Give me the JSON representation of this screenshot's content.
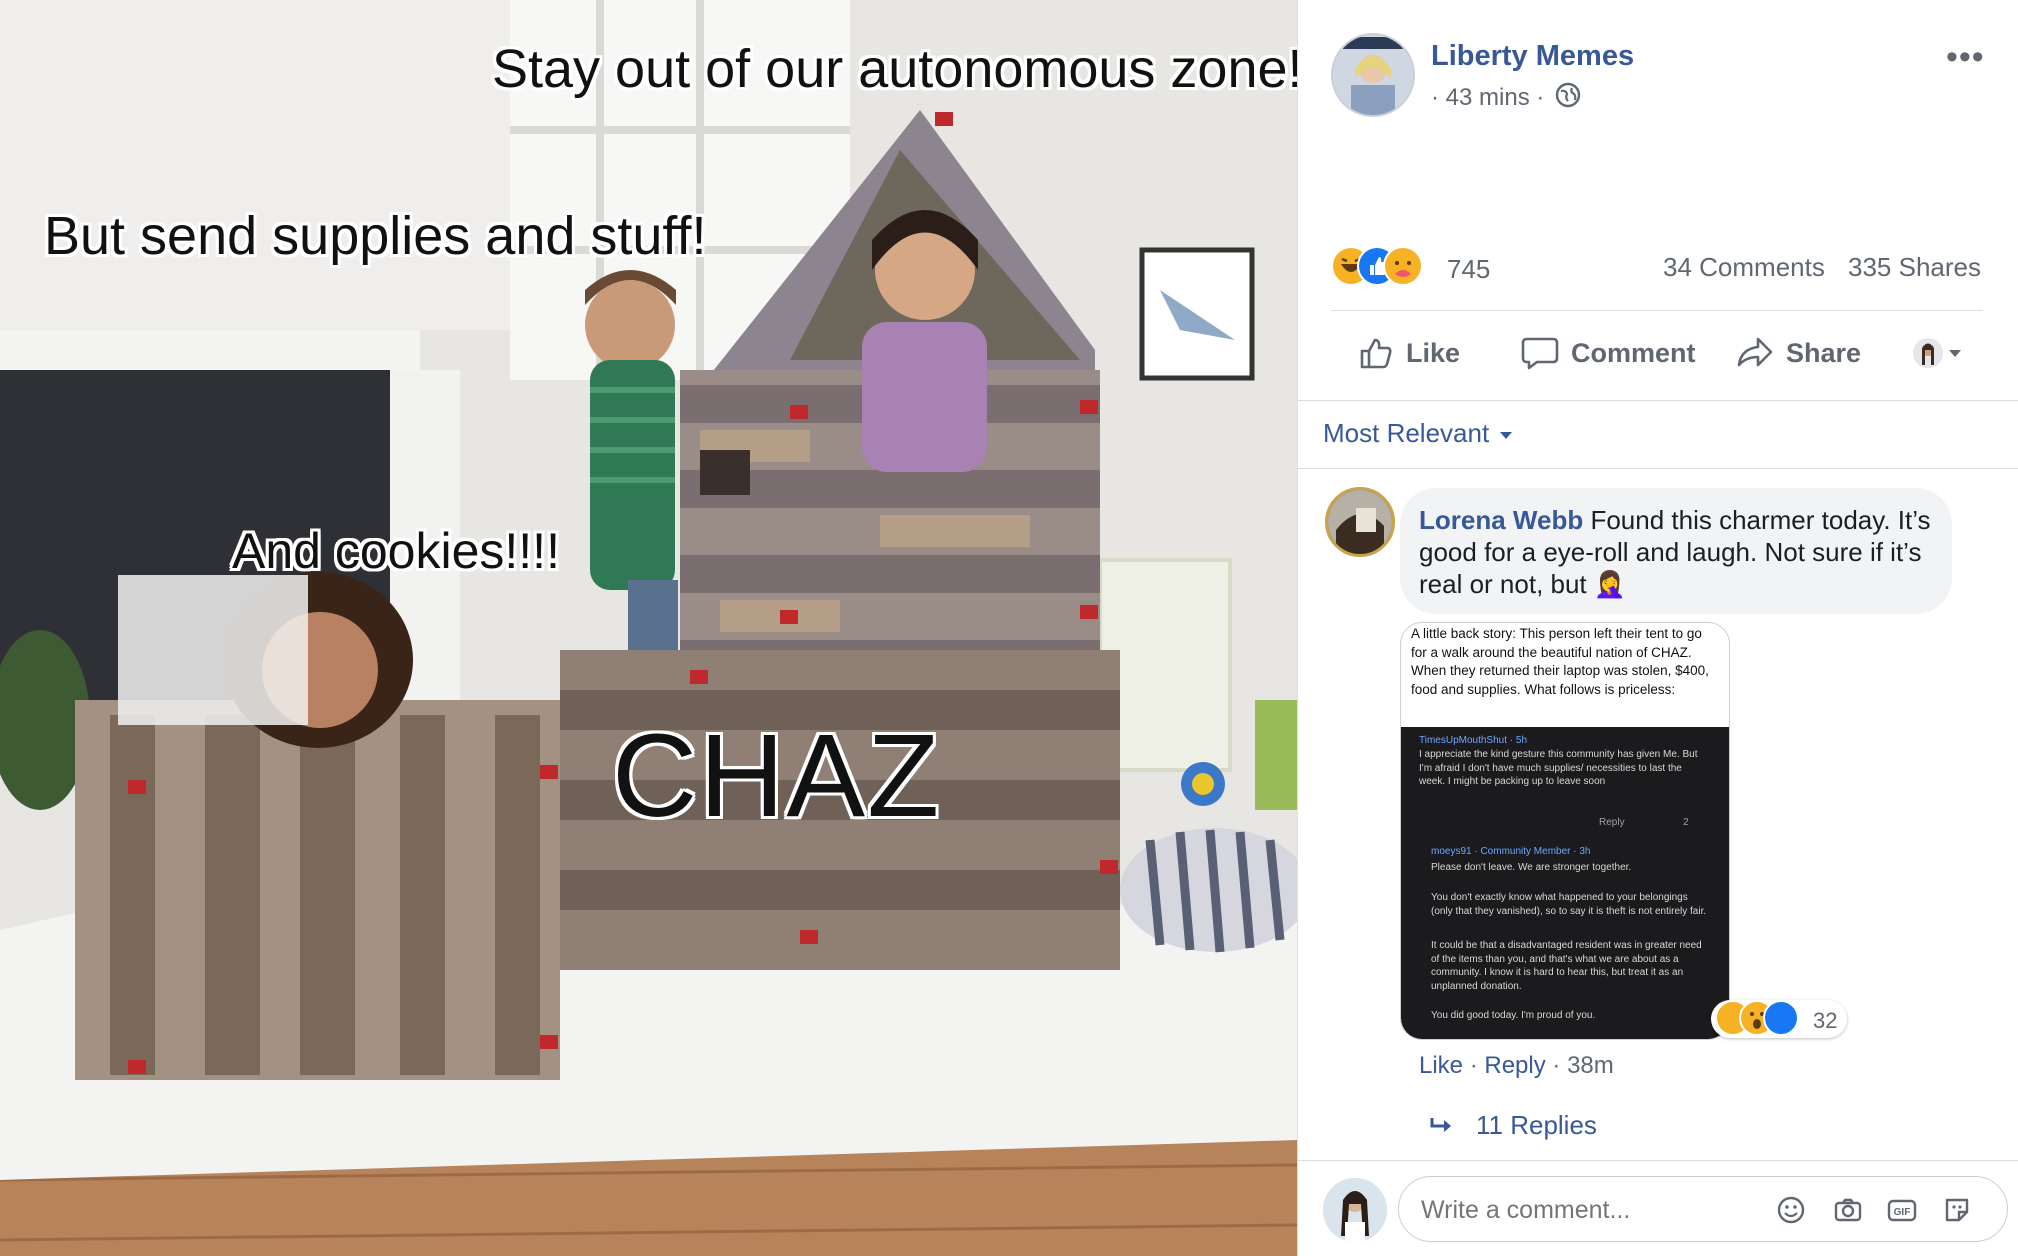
{
  "meme": {
    "caption_top": "Stay out of our autonomous zone!",
    "caption_left": "But send supplies and stuff!",
    "caption_cookies": "And cookies!!!!",
    "caption_label": "CHAZ"
  },
  "post": {
    "page_name": "Liberty Memes",
    "time": "· 43 mins ·",
    "more": "•••",
    "reaction_count": "745",
    "reactions": [
      "haha",
      "like",
      "care"
    ],
    "comments": "34 Comments",
    "shares": "335 Shares",
    "actions": {
      "like": "Like",
      "comment": "Comment",
      "share": "Share"
    },
    "sort": "Most Relevant"
  },
  "comment": {
    "author": "Lorena Webb",
    "text": "Found this charmer today. It’s good for a eye-roll and laugh. Not sure if it’s real or not, but",
    "emoji": "🤦‍♀️",
    "screenshot": {
      "intro": "A little back story: This person left their tent to go for a walk around the beautiful nation of CHAZ. When they returned their laptop was stolen, $400, food and supplies. What follows is priceless:",
      "user1": "TimesUpMouthShut · 5h",
      "post1": "I appreciate the kind gesture this community has given Me. But I'm afraid I don't have much supplies/ necessities to last the week. I might be packing up to leave soon",
      "reply_label": "Reply",
      "votes": "2",
      "user2": "moeys91 · Community Member · 3h",
      "line1": "Please don't leave. We are stronger together.",
      "line2": "You don't exactly know what happened to your belongings (only that they vanished), so to say it is theft is not entirely fair.",
      "line3": "It could be that a disadvantaged resident was in greater need of the items than you, and that's what we are about as a community. I know it is hard to hear this, but treat it as an unplanned donation.",
      "line4": "You did good today. I'm proud of you."
    },
    "reaction_count": "32",
    "like": "Like",
    "reply": "Reply",
    "time": "38m",
    "replies": "11 Replies"
  },
  "composer": {
    "placeholder": "Write a comment..."
  }
}
